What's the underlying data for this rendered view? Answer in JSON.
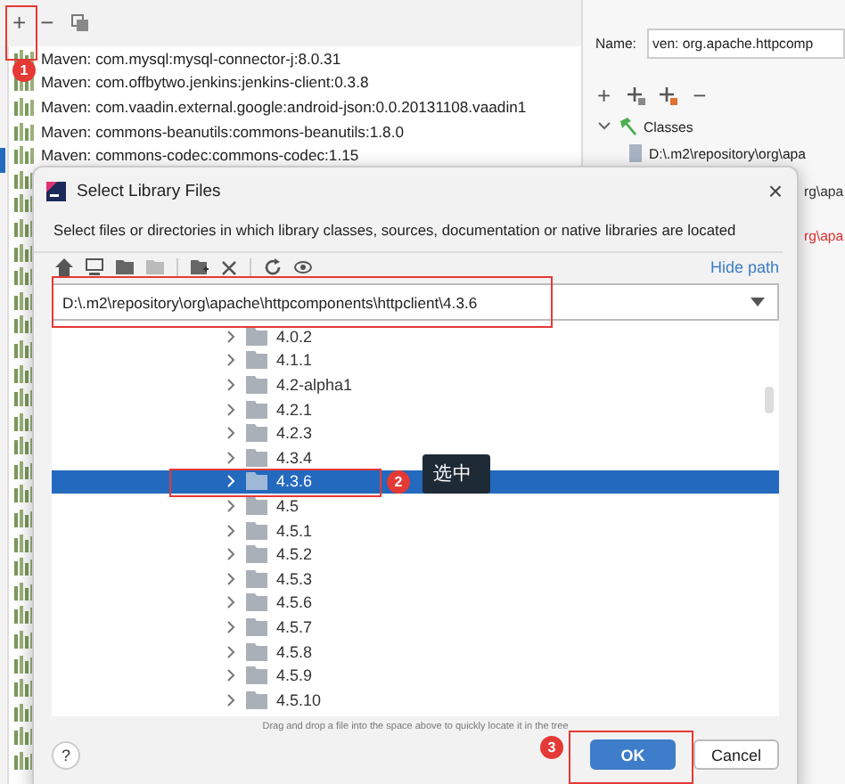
{
  "toolbar": {
    "add": "+",
    "remove": "−"
  },
  "libraries": [
    "Maven: com.mysql:mysql-connector-j:8.0.31",
    "Maven: com.offbytwo.jenkins:jenkins-client:0.3.8",
    "Maven: com.vaadin.external.google:android-json:0.0.20131108.vaadin1",
    "Maven: commons-beanutils:commons-beanutils:1.8.0",
    "Maven: commons-codec:commons-codec:1.15"
  ],
  "details": {
    "name_label": "Name:",
    "name_value": "ven: org.apache.httpcomp",
    "toolbar": {
      "add": "+",
      "remove": "−"
    },
    "tree": [
      {
        "label": "Classes",
        "expanded": true,
        "children": [
          {
            "label": "D:\\.m2\\repository\\org\\apa"
          }
        ]
      }
    ],
    "fragments": [
      {
        "text": "rg\\apa",
        "kind": "normal"
      },
      {
        "text": "rg\\apa",
        "kind": "error"
      }
    ]
  },
  "dialog": {
    "title": "Select Library Files",
    "close": "×",
    "description": "Select files or directories in which library classes, sources, documentation or native libraries are located",
    "hide_path": "Hide path",
    "path": "D:\\.m2\\repository\\org\\apache\\httpcomponents\\httpclient\\4.3.6",
    "tree": [
      {
        "label": "4.0.2",
        "selected": false
      },
      {
        "label": "4.1.1",
        "selected": false
      },
      {
        "label": "4.2-alpha1",
        "selected": false
      },
      {
        "label": "4.2.1",
        "selected": false
      },
      {
        "label": "4.2.3",
        "selected": false
      },
      {
        "label": "4.3.4",
        "selected": false
      },
      {
        "label": "4.3.6",
        "selected": true
      },
      {
        "label": "4.5",
        "selected": false
      },
      {
        "label": "4.5.1",
        "selected": false
      },
      {
        "label": "4.5.2",
        "selected": false
      },
      {
        "label": "4.5.3",
        "selected": false
      },
      {
        "label": "4.5.6",
        "selected": false
      },
      {
        "label": "4.5.7",
        "selected": false
      },
      {
        "label": "4.5.8",
        "selected": false
      },
      {
        "label": "4.5.9",
        "selected": false
      },
      {
        "label": "4.5.10",
        "selected": false
      }
    ],
    "hint": "Drag and drop a file into the space above to quickly locate it in the tree",
    "help": "?",
    "buttons": [
      {
        "label": "OK",
        "kind": "primary"
      },
      {
        "label": "Cancel",
        "kind": "secondary"
      }
    ]
  },
  "annotations": [
    {
      "number": "1"
    },
    {
      "number": "2",
      "tooltip": "选中"
    },
    {
      "number": "3"
    }
  ]
}
